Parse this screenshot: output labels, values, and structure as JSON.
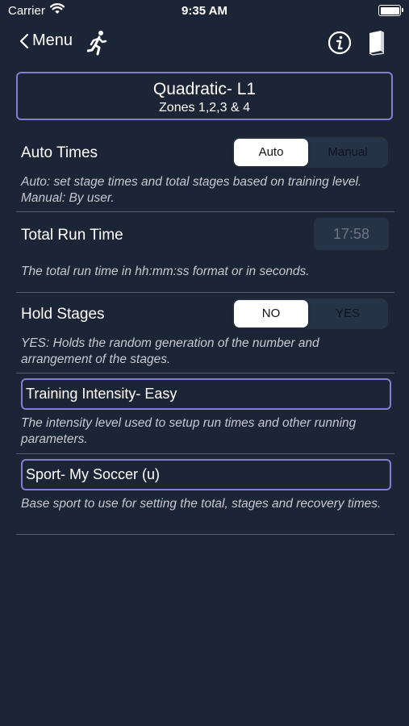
{
  "status_bar": {
    "carrier": "Carrier",
    "time": "9:35 AM"
  },
  "nav": {
    "back_label": "Menu"
  },
  "header": {
    "title": "Quadratic- L1",
    "subtitle": "Zones 1,2,3 & 4"
  },
  "auto_times": {
    "label": "Auto Times",
    "options": [
      "Auto",
      "Manual"
    ],
    "selected": "Auto",
    "description": "Auto: set stage times and total stages based on training level. Manual: By user."
  },
  "total_run_time": {
    "label": "Total Run Time",
    "value": "17:58",
    "description": "The total run time in hh:mm:ss format or in seconds."
  },
  "hold_stages": {
    "label": "Hold Stages",
    "options": [
      "NO",
      "YES"
    ],
    "selected": "NO",
    "description": "YES: Holds the random generation of the number and arrangement of the stages."
  },
  "training_intensity": {
    "value": "Training Intensity- Easy",
    "description": "The intensity level used to setup run times and other running parameters."
  },
  "sport": {
    "value": "Sport- My Soccer (u)",
    "description": "Base sport to use for setting the total, stages and recovery times."
  },
  "colors": {
    "background": "#1c2535",
    "accent_border": "#7f7fd6",
    "segment_bg": "#263245"
  }
}
